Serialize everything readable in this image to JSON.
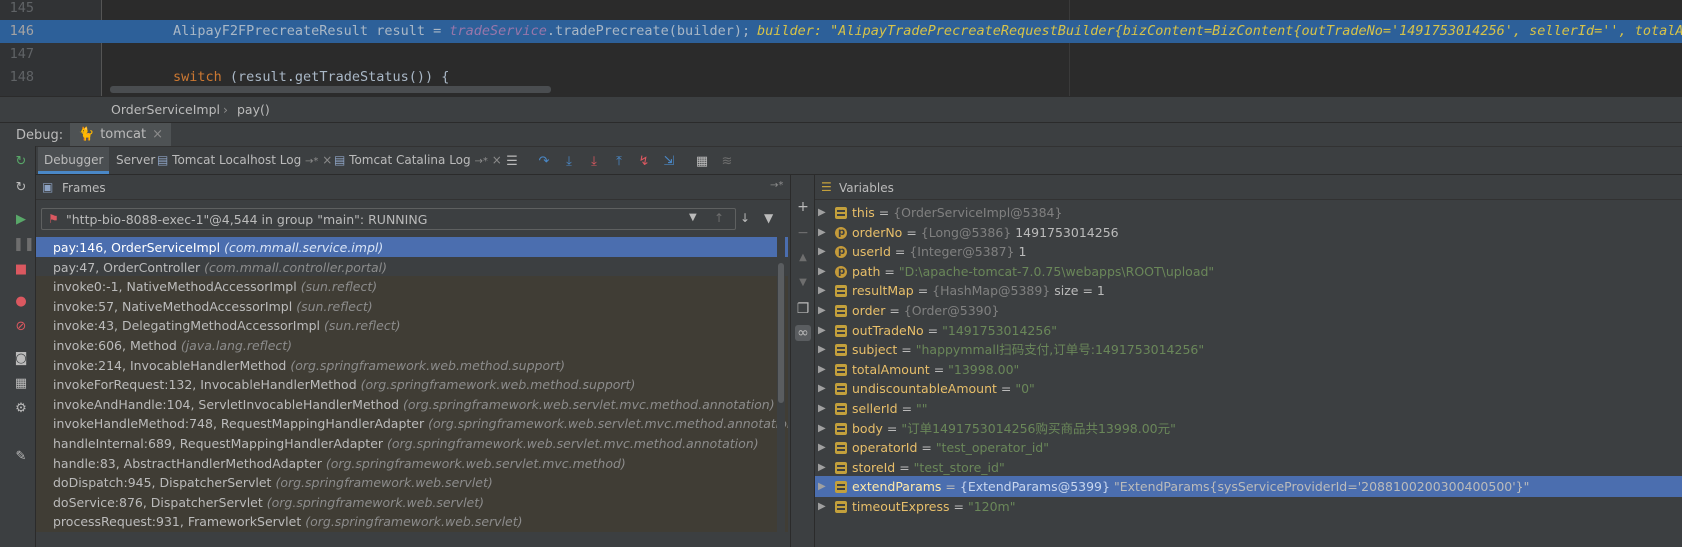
{
  "editor": {
    "lines": [
      {
        "num": "145",
        "code": "",
        "highlighted": false
      },
      {
        "num": "146",
        "code_prefix": "AlipayF2FPrecreateResult result = ",
        "code_field": "tradeService",
        "code_suffix": ".tradePrecreate(builder);",
        "hint": "builder: \"AlipayTradePrecreateRequestBuilder{bizContent=BizContent{outTradeNo='1491753014256', sellerId='', totalAmo",
        "highlighted": true
      },
      {
        "num": "147",
        "code": "",
        "highlighted": false
      },
      {
        "num": "148",
        "code_kw": "switch",
        "code_rest": " (result.getTradeStatus()) {",
        "highlighted": false
      }
    ]
  },
  "breadcrumb": {
    "class_name": "OrderServiceImpl",
    "method_name": "pay()"
  },
  "debug": {
    "title": "Debug:",
    "session_tab": "tomcat",
    "close_glyph": "×"
  },
  "toolbar": {
    "tabs": [
      {
        "label": "Debugger",
        "active": true
      },
      {
        "label": "Server",
        "active": false
      },
      {
        "label": "Tomcat Localhost Log",
        "suffix": "→*",
        "active": false
      },
      {
        "label": "Tomcat Catalina Log",
        "suffix": "→*",
        "active": false
      }
    ]
  },
  "frames": {
    "title": "Frames",
    "pin_glyph": "→*",
    "thread": "\"http-bio-8088-exec-1\"@4,544 in group \"main\": RUNNING",
    "items": [
      {
        "method": "pay:146, OrderServiceImpl",
        "pkg": "(com.mmall.service.impl)",
        "kind": "sel"
      },
      {
        "method": "pay:47, OrderController",
        "pkg": "(com.mmall.controller.portal)",
        "kind": "app"
      },
      {
        "method": "invoke0:-1, NativeMethodAccessorImpl",
        "pkg": "(sun.reflect)",
        "kind": "lib"
      },
      {
        "method": "invoke:57, NativeMethodAccessorImpl",
        "pkg": "(sun.reflect)",
        "kind": "lib"
      },
      {
        "method": "invoke:43, DelegatingMethodAccessorImpl",
        "pkg": "(sun.reflect)",
        "kind": "lib"
      },
      {
        "method": "invoke:606, Method",
        "pkg": "(java.lang.reflect)",
        "kind": "lib"
      },
      {
        "method": "invoke:214, InvocableHandlerMethod",
        "pkg": "(org.springframework.web.method.support)",
        "kind": "lib"
      },
      {
        "method": "invokeForRequest:132, InvocableHandlerMethod",
        "pkg": "(org.springframework.web.method.support)",
        "kind": "lib"
      },
      {
        "method": "invokeAndHandle:104, ServletInvocableHandlerMethod",
        "pkg": "(org.springframework.web.servlet.mvc.method.annotation)",
        "kind": "lib"
      },
      {
        "method": "invokeHandleMethod:748, RequestMappingHandlerAdapter",
        "pkg": "(org.springframework.web.servlet.mvc.method.annotation)",
        "kind": "lib"
      },
      {
        "method": "handleInternal:689, RequestMappingHandlerAdapter",
        "pkg": "(org.springframework.web.servlet.mvc.method.annotation)",
        "kind": "lib"
      },
      {
        "method": "handle:83, AbstractHandlerMethodAdapter",
        "pkg": "(org.springframework.web.servlet.mvc.method)",
        "kind": "lib"
      },
      {
        "method": "doDispatch:945, DispatcherServlet",
        "pkg": "(org.springframework.web.servlet)",
        "kind": "lib"
      },
      {
        "method": "doService:876, DispatcherServlet",
        "pkg": "(org.springframework.web.servlet)",
        "kind": "lib"
      },
      {
        "method": "processRequest:931, FrameworkServlet",
        "pkg": "(org.springframework.web.servlet)",
        "kind": "lib"
      }
    ]
  },
  "variables": {
    "title": "Variables",
    "items": [
      {
        "icon": "field",
        "name": "this",
        "eq": " = ",
        "type": "{OrderServiceImpl@5384}",
        "value": "",
        "selected": false
      },
      {
        "icon": "param",
        "name": "orderNo",
        "eq": " = ",
        "type": "{Long@5386}",
        "value": " 1491753014256",
        "selected": false
      },
      {
        "icon": "param",
        "name": "userId",
        "eq": " = ",
        "type": "{Integer@5387}",
        "value": " 1",
        "selected": false
      },
      {
        "icon": "param",
        "name": "path",
        "eq": " = ",
        "type": "",
        "value": "\"D:\\apache-tomcat-7.0.75\\webapps\\ROOT\\upload\"",
        "string": true,
        "selected": false
      },
      {
        "icon": "field",
        "name": "resultMap",
        "eq": " = ",
        "type": "{HashMap@5389}",
        "value": "  size = 1",
        "selected": false
      },
      {
        "icon": "field",
        "name": "order",
        "eq": " = ",
        "type": "{Order@5390}",
        "value": "",
        "selected": false
      },
      {
        "icon": "field",
        "name": "outTradeNo",
        "eq": " = ",
        "type": "",
        "value": "\"1491753014256\"",
        "string": true,
        "selected": false
      },
      {
        "icon": "field",
        "name": "subject",
        "eq": " = ",
        "type": "",
        "value": "\"happymmall扫码支付,订单号:1491753014256\"",
        "string": true,
        "selected": false
      },
      {
        "icon": "field",
        "name": "totalAmount",
        "eq": " = ",
        "type": "",
        "value": "\"13998.00\"",
        "string": true,
        "selected": false
      },
      {
        "icon": "field",
        "name": "undiscountableAmount",
        "eq": " = ",
        "type": "",
        "value": "\"0\"",
        "string": true,
        "selected": false
      },
      {
        "icon": "field",
        "name": "sellerId",
        "eq": " = ",
        "type": "",
        "value": "\"\"",
        "string": true,
        "selected": false
      },
      {
        "icon": "field",
        "name": "body",
        "eq": " = ",
        "type": "",
        "value": "\"订单1491753014256购买商品共13998.00元\"",
        "string": true,
        "selected": false
      },
      {
        "icon": "field",
        "name": "operatorId",
        "eq": " = ",
        "type": "",
        "value": "\"test_operator_id\"",
        "string": true,
        "selected": false
      },
      {
        "icon": "field",
        "name": "storeId",
        "eq": " = ",
        "type": "",
        "value": "\"test_store_id\"",
        "string": true,
        "selected": false
      },
      {
        "icon": "field",
        "name": "extendParams",
        "eq": " = ",
        "type": "{ExtendParams@5399}",
        "value": " \"ExtendParams{sysServiceProviderId='2088100200300400500'}\"",
        "selected": true
      },
      {
        "icon": "field",
        "name": "timeoutExpress",
        "eq": " = ",
        "type": "",
        "value": "\"120m\"",
        "string": true,
        "selected": false
      }
    ]
  },
  "colors": {
    "accent": "#4b6eaf",
    "highlight_line": "#2d6099",
    "string": "#6a8759",
    "keyword": "#cc7832",
    "field_name": "#e8bf6a"
  }
}
